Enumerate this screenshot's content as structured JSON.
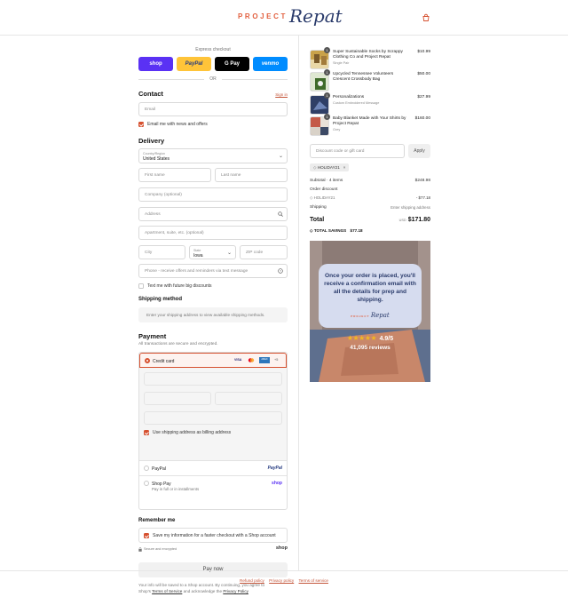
{
  "brand": {
    "word": "PROJECT",
    "script": "Repat"
  },
  "express": {
    "label": "Express checkout",
    "buttons": [
      {
        "label": "shop",
        "bg": "#5a31f4",
        "fg": "#ffffff"
      },
      {
        "label": "PayPal",
        "bg": "#ffc439",
        "fg": "#253b80"
      },
      {
        "label": "G Pay",
        "bg": "#000000",
        "fg": "#ffffff"
      },
      {
        "label": "venmo",
        "bg": "#008cff",
        "fg": "#ffffff"
      }
    ],
    "or": "OR"
  },
  "contact": {
    "title": "Contact",
    "signin": "Sign in",
    "email_placeholder": "Email",
    "news_label": "Email me with news and offers"
  },
  "delivery": {
    "title": "Delivery",
    "country_label": "Country/Region",
    "country_value": "United States",
    "first_name": "First name",
    "last_name": "Last name",
    "company": "Company (optional)",
    "address": "Address",
    "apartment": "Apartment, suite, etc. (optional)",
    "city": "City",
    "state_label": "State",
    "state_value": "Iowa",
    "zip": "ZIP code",
    "phone": "Phone - receive offers and reminders via text message",
    "text_label": "Text me with future big discounts"
  },
  "shipping": {
    "title": "Shipping method",
    "note": "Enter your shipping address to view available shipping methods."
  },
  "payment": {
    "title": "Payment",
    "subtitle": "All transactions are secure and encrypted.",
    "credit_card": "Credit card",
    "card_badges": [
      "VISA",
      "MC",
      "AMEX",
      "+5"
    ],
    "billing_same": "Use shipping address as billing address",
    "paypal": "PayPal",
    "paypal_logo": "PayPal",
    "shop_pay": "Shop Pay",
    "shop_pay_sub": "Pay in full or in installments",
    "shop_logo": "shop"
  },
  "remember": {
    "title": "Remember me",
    "save_label": "Save my information for a faster checkout with a Shop account",
    "secure": "Secure and encrypted",
    "shop_logo": "shop"
  },
  "pay_now": "Pay now",
  "legal": {
    "text1": "Your info will be saved to a Shop account. By continuing, you agree to",
    "text2a": "Shop's",
    "tos": "Terms of Service",
    "text2b": "and acknowledge the",
    "privacy": "Privacy Policy"
  },
  "footer": [
    "Refund policy",
    "Privacy policy",
    "Terms of service"
  ],
  "cart": {
    "items": [
      {
        "qty": "1",
        "name": "Super Sustainable Socks by Scrappy Clothing Co and Project Repat",
        "sub": "Single Pair",
        "price": "$10.99",
        "thumb": "#c9a24a"
      },
      {
        "qty": "1",
        "name": "Upcycled Tennessee Volunteers Crescent Crossbody Bag",
        "sub": "",
        "price": "$50.00",
        "thumb": "#5f7a3a"
      },
      {
        "qty": "1",
        "name": "Personalizations",
        "sub": "Custom Embroidered Message",
        "price": "$27.99",
        "thumb": "#3e4f7a"
      },
      {
        "qty": "1",
        "name": "Baby Blanket Made with Your Shirts by Project Repat",
        "sub": "Grey",
        "price": "$160.00",
        "thumb": "#b04a3c"
      }
    ],
    "discount_placeholder": "Discount code or gift card",
    "apply": "Apply",
    "code_tag": "HOLIDAY21",
    "subtotal_label": "Subtotal · 4 items",
    "subtotal": "$248.98",
    "order_discount": "Order discount",
    "discount_code": "HOLIDAY21",
    "discount_value": "- $77.18",
    "shipping_label": "Shipping",
    "shipping_value": "Enter shipping address",
    "total_label": "Total",
    "currency": "USD",
    "total": "$171.80",
    "savings_label": "TOTAL SAVINGS",
    "savings": "$77.18"
  },
  "promo": {
    "headline": "Once your order is placed, you'll receive a confirmation email with all the details for prep and shipping.",
    "brand_word": "PROJECT",
    "brand_script": "Repat",
    "stars": "★★★★★",
    "rating": "4.9/5",
    "reviews": "41,095 reviews"
  },
  "colors": {
    "accent": "#d6502f",
    "brand_blue": "#2a3b6b"
  }
}
